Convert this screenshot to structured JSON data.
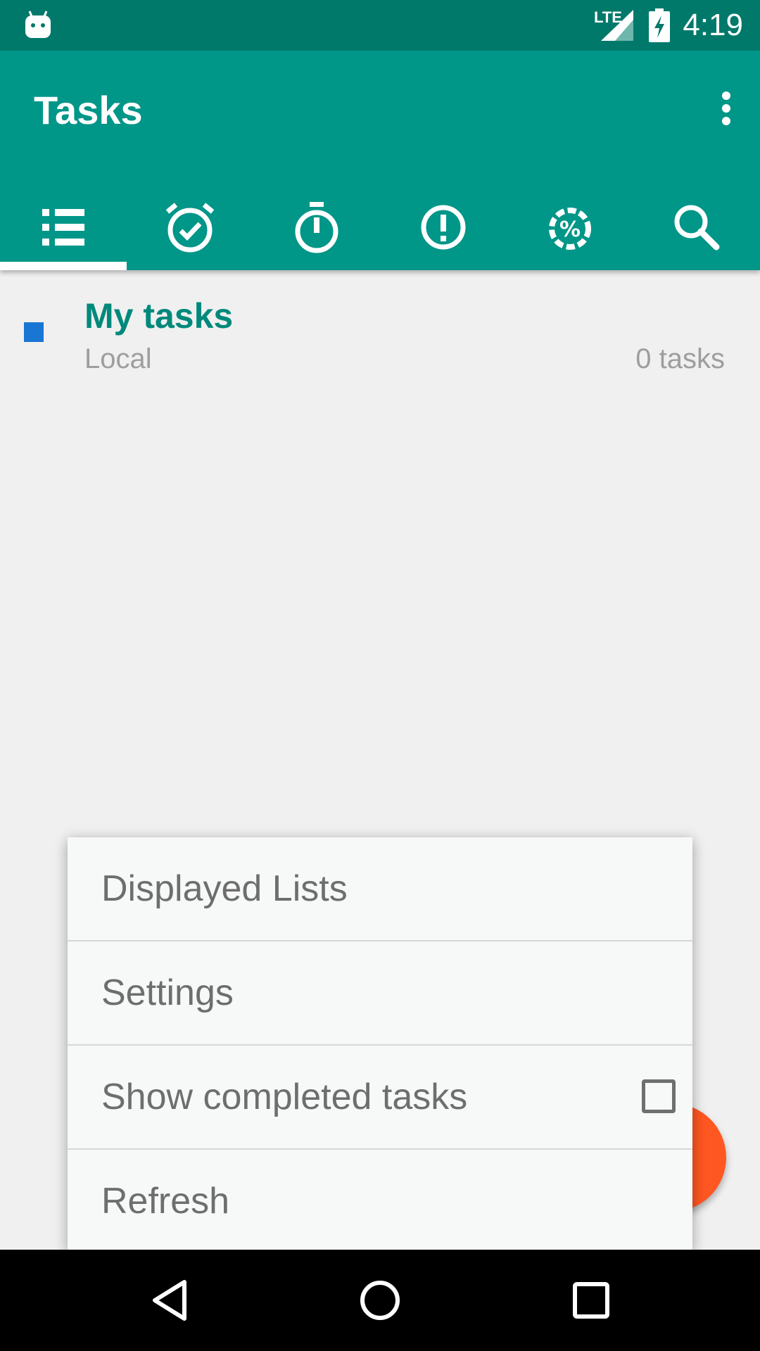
{
  "status_bar": {
    "network": "LTE",
    "time": "4:19"
  },
  "app_bar": {
    "title": "Tasks"
  },
  "tabs": [
    {
      "icon": "list-icon",
      "selected": true
    },
    {
      "icon": "alarm-check-icon",
      "selected": false
    },
    {
      "icon": "stopwatch-icon",
      "selected": false
    },
    {
      "icon": "priority-icon",
      "selected": false
    },
    {
      "icon": "progress-icon",
      "selected": false
    },
    {
      "icon": "search-icon",
      "selected": false
    }
  ],
  "task_list": {
    "name": "My tasks",
    "account": "Local",
    "count_label": "0 tasks",
    "color": "#1976d2"
  },
  "menu": {
    "items": [
      {
        "label": "Displayed Lists"
      },
      {
        "label": "Settings"
      },
      {
        "label": "Show completed tasks",
        "checked": false
      },
      {
        "label": "Refresh"
      }
    ]
  },
  "colors": {
    "primary": "#009688",
    "primary_dark": "#00796b",
    "accent": "#ff5722",
    "list_name": "#00897b"
  }
}
